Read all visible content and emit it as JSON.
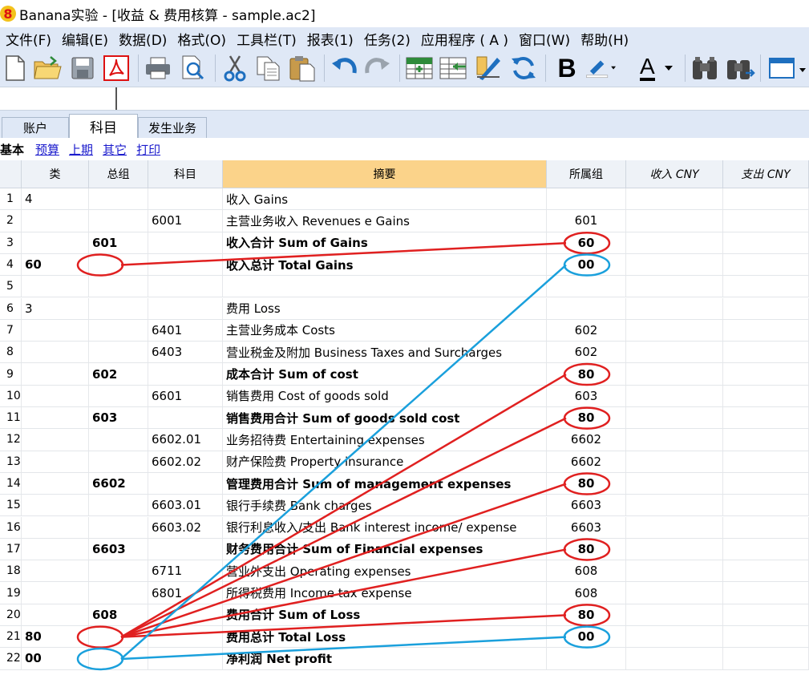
{
  "window": {
    "title": "Banana实验 - [收益 & 费用核算 - sample.ac2]",
    "logo": "8"
  },
  "menu": [
    "文件(F)",
    "编辑(E)",
    "数据(D)",
    "格式(O)",
    "工具栏(T)",
    "报表(1)",
    "任务(2)",
    "应用程序 ( A )",
    "窗口(W)",
    "帮助(H)"
  ],
  "toolbar": {
    "icons": [
      "new-file-icon",
      "open-folder-icon",
      "save-icon",
      "pdf-icon",
      "print-icon",
      "print-preview-icon",
      "cut-icon",
      "copy-icon",
      "paste-icon",
      "undo-icon",
      "redo-icon",
      "insert-row-icon",
      "delete-row-icon",
      "edit-pencil-icon",
      "refresh-icon",
      "bold-icon",
      "highlight-icon",
      "font-color-icon",
      "find-icon",
      "find-next-icon",
      "window-icon"
    ],
    "bold_label": "B",
    "font_color_label": "A"
  },
  "tabs": [
    "账户",
    "科目",
    "发生业务"
  ],
  "views": [
    "基本",
    "预算",
    "上期",
    "其它",
    "打印"
  ],
  "columns": [
    "类",
    "总组",
    "科目",
    "摘要",
    "所属组",
    "收入 CNY",
    "支出 CNY"
  ],
  "rows": [
    {
      "n": "1",
      "cls": "4",
      "grp": "",
      "acct": "",
      "desc": "收入 Gains",
      "belongs": "",
      "bold": false
    },
    {
      "n": "2",
      "cls": "",
      "grp": "",
      "acct": "6001",
      "desc": "主营业务收入 Revenues e Gains",
      "belongs": "601",
      "bold": false
    },
    {
      "n": "3",
      "cls": "",
      "grp": "601",
      "acct": "",
      "desc": "收入合计 Sum of Gains",
      "belongs": "60",
      "bold": true
    },
    {
      "n": "4",
      "cls": "60",
      "grp": "",
      "acct": "",
      "desc": "收入总计 Total Gains",
      "belongs": "00",
      "bold": true
    },
    {
      "n": "5",
      "cls": "",
      "grp": "",
      "acct": "",
      "desc": "",
      "belongs": "",
      "bold": false
    },
    {
      "n": "6",
      "cls": "3",
      "grp": "",
      "acct": "",
      "desc": "费用 Loss",
      "belongs": "",
      "bold": false
    },
    {
      "n": "7",
      "cls": "",
      "grp": "",
      "acct": "6401",
      "desc": "主营业务成本 Costs",
      "belongs": "602",
      "bold": false
    },
    {
      "n": "8",
      "cls": "",
      "grp": "",
      "acct": "6403",
      "desc": "营业税金及附加 Business Taxes and Surcharges",
      "belongs": "602",
      "bold": false
    },
    {
      "n": "9",
      "cls": "",
      "grp": "602",
      "acct": "",
      "desc": "成本合计 Sum of cost",
      "belongs": "80",
      "bold": true
    },
    {
      "n": "10",
      "cls": "",
      "grp": "",
      "acct": "6601",
      "desc": "销售费用 Cost of goods sold",
      "belongs": "603",
      "bold": false
    },
    {
      "n": "11",
      "cls": "",
      "grp": "603",
      "acct": "",
      "desc": "销售费用合计 Sum of goods sold cost",
      "belongs": "80",
      "bold": true
    },
    {
      "n": "12",
      "cls": "",
      "grp": "",
      "acct": "6602.01",
      "desc": "业务招待费 Entertaining expenses",
      "belongs": "6602",
      "bold": false
    },
    {
      "n": "13",
      "cls": "",
      "grp": "",
      "acct": "6602.02",
      "desc": "财产保险费 Property insurance",
      "belongs": "6602",
      "bold": false
    },
    {
      "n": "14",
      "cls": "",
      "grp": "6602",
      "acct": "",
      "desc": "管理费用合计 Sum of management expenses",
      "belongs": "80",
      "bold": true
    },
    {
      "n": "15",
      "cls": "",
      "grp": "",
      "acct": "6603.01",
      "desc": "银行手续费 Bank charges",
      "belongs": "6603",
      "bold": false
    },
    {
      "n": "16",
      "cls": "",
      "grp": "",
      "acct": "6603.02",
      "desc": "银行利息收入/支出 Bank interest income/ expense",
      "belongs": "6603",
      "bold": false
    },
    {
      "n": "17",
      "cls": "",
      "grp": "6603",
      "acct": "",
      "desc": "财务费用合计 Sum of Financial expenses",
      "belongs": "80",
      "bold": true
    },
    {
      "n": "18",
      "cls": "",
      "grp": "",
      "acct": "6711",
      "desc": "营业外支出 Operating expenses",
      "belongs": "608",
      "bold": false
    },
    {
      "n": "19",
      "cls": "",
      "grp": "",
      "acct": "6801",
      "desc": "所得税费用 Income tax expense",
      "belongs": "608",
      "bold": false
    },
    {
      "n": "20",
      "cls": "",
      "grp": "608",
      "acct": "",
      "desc": "费用合计 Sum of Loss",
      "belongs": "80",
      "bold": true
    },
    {
      "n": "21",
      "cls": "80",
      "grp": "",
      "acct": "",
      "desc": "费用总计 Total Loss",
      "belongs": "00",
      "bold": true
    },
    {
      "n": "22",
      "cls": "00",
      "grp": "",
      "acct": "",
      "desc": "净利润 Net profit",
      "belongs": "",
      "bold": true
    }
  ],
  "annotations": {
    "red": "#e02020",
    "blue": "#1aa0dc",
    "red_links": [
      {
        "from_row": 4,
        "from_col": "cls",
        "to_row": 3,
        "to_col": "belongs"
      },
      {
        "from_row": 21,
        "from_col": "cls",
        "to_row": 9,
        "to_col": "belongs"
      },
      {
        "from_row": 21,
        "from_col": "cls",
        "to_row": 11,
        "to_col": "belongs"
      },
      {
        "from_row": 21,
        "from_col": "cls",
        "to_row": 14,
        "to_col": "belongs"
      },
      {
        "from_row": 21,
        "from_col": "cls",
        "to_row": 17,
        "to_col": "belongs"
      },
      {
        "from_row": 21,
        "from_col": "cls",
        "to_row": 20,
        "to_col": "belongs"
      }
    ],
    "blue_links": [
      {
        "from_row": 22,
        "from_col": "cls",
        "to_row": 4,
        "to_col": "belongs"
      },
      {
        "from_row": 22,
        "from_col": "cls",
        "to_row": 21,
        "to_col": "belongs"
      }
    ]
  }
}
